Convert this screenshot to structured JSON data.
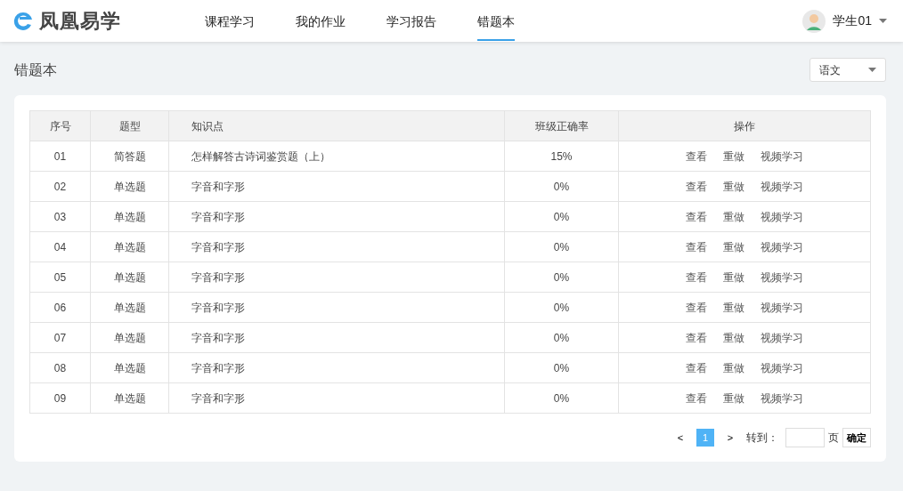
{
  "brand": "凤凰易学",
  "nav": [
    {
      "label": "课程学习",
      "selected": false
    },
    {
      "label": "我的作业",
      "selected": false
    },
    {
      "label": "学习报告",
      "selected": false
    },
    {
      "label": "错题本",
      "selected": true
    }
  ],
  "user": {
    "name": "学生01"
  },
  "page_title": "错题本",
  "subject_select": {
    "value": "语文"
  },
  "table": {
    "columns": [
      "序号",
      "题型",
      "知识点",
      "班级正确率",
      "操作"
    ],
    "rows": [
      {
        "no": "01",
        "type": "简答题",
        "topic": "怎样解答古诗词鉴赏题（上）",
        "rate": "15%",
        "actions": [
          "查看",
          "重做",
          "视频学习"
        ]
      },
      {
        "no": "02",
        "type": "单选题",
        "topic": "字音和字形",
        "rate": "0%",
        "actions": [
          "查看",
          "重做",
          "视频学习"
        ]
      },
      {
        "no": "03",
        "type": "单选题",
        "topic": "字音和字形",
        "rate": "0%",
        "actions": [
          "查看",
          "重做",
          "视频学习"
        ]
      },
      {
        "no": "04",
        "type": "单选题",
        "topic": "字音和字形",
        "rate": "0%",
        "actions": [
          "查看",
          "重做",
          "视频学习"
        ]
      },
      {
        "no": "05",
        "type": "单选题",
        "topic": "字音和字形",
        "rate": "0%",
        "actions": [
          "查看",
          "重做",
          "视频学习"
        ]
      },
      {
        "no": "06",
        "type": "单选题",
        "topic": "字音和字形",
        "rate": "0%",
        "actions": [
          "查看",
          "重做",
          "视频学习"
        ]
      },
      {
        "no": "07",
        "type": "单选题",
        "topic": "字音和字形",
        "rate": "0%",
        "actions": [
          "查看",
          "重做",
          "视频学习"
        ]
      },
      {
        "no": "08",
        "type": "单选题",
        "topic": "字音和字形",
        "rate": "0%",
        "actions": [
          "查看",
          "重做",
          "视频学习"
        ]
      },
      {
        "no": "09",
        "type": "单选题",
        "topic": "字音和字形",
        "rate": "0%",
        "actions": [
          "查看",
          "重做",
          "视频学习"
        ]
      }
    ]
  },
  "pagination": {
    "prev": "<",
    "pages": [
      {
        "label": "1",
        "selected": true
      }
    ],
    "next": ">",
    "goto_label": "转到：",
    "page_unit": "页",
    "confirm": "确定"
  }
}
